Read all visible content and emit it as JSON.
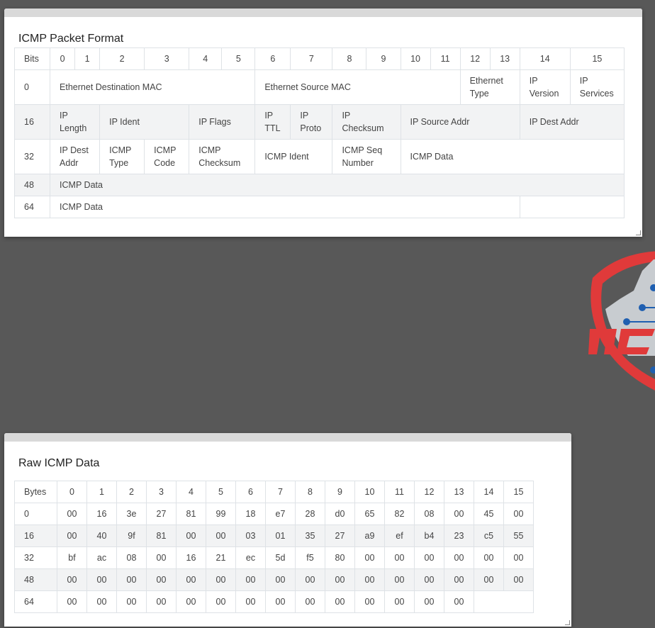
{
  "packet_panel": {
    "title": "ICMP Packet Format",
    "header": [
      "Bits",
      "0",
      "1",
      "2",
      "3",
      "4",
      "5",
      "6",
      "7",
      "8",
      "9",
      "10",
      "11",
      "12",
      "13",
      "14",
      "15"
    ],
    "rows": [
      {
        "offset": "0",
        "cells": [
          "Ethernet Destination MAC",
          "Ethernet Source MAC",
          "Ethernet Type",
          "IP Version",
          "IP Services"
        ]
      },
      {
        "offset": "16",
        "cells": [
          "IP Length",
          "IP Ident",
          "IP Flags",
          "IP TTL",
          "IP Proto",
          "IP Checksum",
          "IP Source Addr",
          "IP Dest Addr"
        ]
      },
      {
        "offset": "32",
        "cells": [
          "IP Dest Addr",
          "ICMP Type",
          "ICMP Code",
          "ICMP Checksum",
          "ICMP Ident",
          "ICMP Seq Number",
          "ICMP Data"
        ]
      },
      {
        "offset": "48",
        "cells": [
          "ICMP Data"
        ]
      },
      {
        "offset": "64",
        "cells": [
          "ICMP Data",
          ""
        ]
      }
    ]
  },
  "raw_panel": {
    "title": "Raw ICMP Data",
    "header": [
      "Bytes",
      "0",
      "1",
      "2",
      "3",
      "4",
      "5",
      "6",
      "7",
      "8",
      "9",
      "10",
      "11",
      "12",
      "13",
      "14",
      "15"
    ],
    "rows": [
      {
        "offset": "0",
        "bytes": [
          "00",
          "16",
          "3e",
          "27",
          "81",
          "99",
          "18",
          "e7",
          "28",
          "d0",
          "65",
          "82",
          "08",
          "00",
          "45",
          "00"
        ]
      },
      {
        "offset": "16",
        "bytes": [
          "00",
          "40",
          "9f",
          "81",
          "00",
          "00",
          "03",
          "01",
          "35",
          "27",
          "a9",
          "ef",
          "b4",
          "23",
          "c5",
          "55"
        ]
      },
      {
        "offset": "32",
        "bytes": [
          "bf",
          "ac",
          "08",
          "00",
          "16",
          "21",
          "ec",
          "5d",
          "f5",
          "80",
          "00",
          "00",
          "00",
          "00",
          "00",
          "00"
        ]
      },
      {
        "offset": "48",
        "bytes": [
          "00",
          "00",
          "00",
          "00",
          "00",
          "00",
          "00",
          "00",
          "00",
          "00",
          "00",
          "00",
          "00",
          "00",
          "00",
          "00"
        ]
      },
      {
        "offset": "64",
        "bytes": [
          "00",
          "00",
          "00",
          "00",
          "00",
          "00",
          "00",
          "00",
          "00",
          "00",
          "00",
          "00",
          "00",
          "00"
        ]
      }
    ]
  },
  "logo": {
    "icon": "shield-logo",
    "primary_color": "#e03a3a",
    "circuit_color": "#1f5fb0",
    "gray": "#c8ccd0"
  }
}
